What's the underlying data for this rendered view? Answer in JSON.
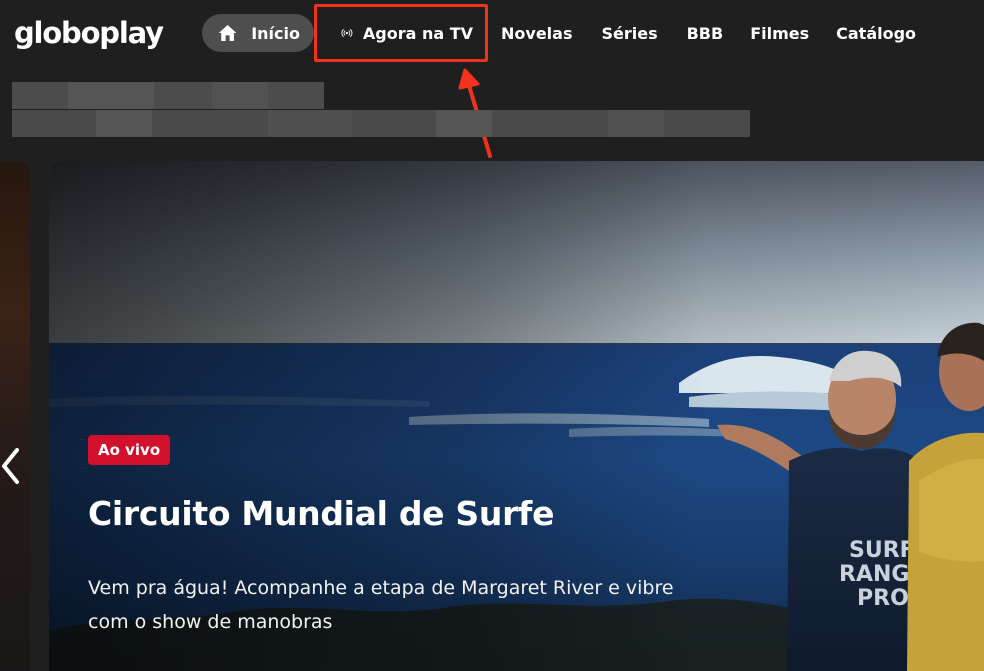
{
  "header": {
    "logo": "globoplay",
    "nav": {
      "inicio": "Início",
      "agora_na_tv": "Agora na TV",
      "novelas": "Novelas",
      "series": "Séries",
      "bbb": "BBB",
      "filmes": "Filmes",
      "catalogo": "Catálogo"
    },
    "active_item": "Início",
    "highlighted_item": "Agora na TV"
  },
  "hero": {
    "badge": "Ao vivo",
    "title": "Circuito Mundial de Surfe",
    "description": "Vem pra água! Acompanhe a etapa de Margaret River e vibre com o show de manobras"
  },
  "icons": {
    "home": "home-icon",
    "live_tv": "broadcast-icon",
    "previous": "chevron-left-icon"
  },
  "colors": {
    "background": "#1f1f1f",
    "active_pill": "#4e4e4e",
    "annotation": "#f2321a",
    "live_badge": "#d3102b"
  }
}
